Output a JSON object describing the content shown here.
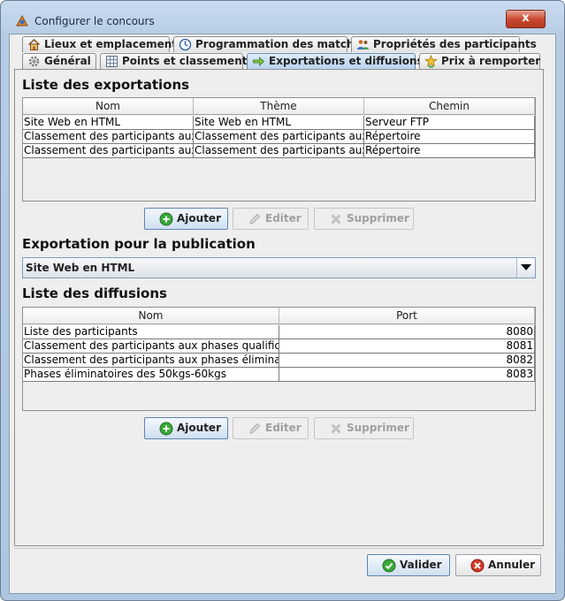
{
  "window": {
    "title": "Configurer le concours",
    "close_label": "x"
  },
  "tabs": {
    "row1": [
      {
        "label": "Lieux et emplacements",
        "icon": "house-icon"
      },
      {
        "label": "Programmation des matchs",
        "icon": "clock-icon"
      },
      {
        "label": "Propriétés des participants",
        "icon": "people-icon"
      }
    ],
    "row2": [
      {
        "label": "Général",
        "icon": "gear-icon"
      },
      {
        "label": "Points et classement",
        "icon": "grid-icon"
      },
      {
        "label": "Exportations et diffusions",
        "icon": "arrow-right-icon",
        "active": true
      },
      {
        "label": "Prix à remporter",
        "icon": "trophy-icon"
      }
    ]
  },
  "exports": {
    "title": "Liste des exportations",
    "columns": [
      "Nom",
      "Thème",
      "Chemin"
    ],
    "rows": [
      [
        "Site Web en HTML",
        "Site Web en HTML",
        "Serveur FTP"
      ],
      [
        "Classement des participants aux...",
        "Classement des participants aux...",
        "Répertoire"
      ],
      [
        "Classement des participants aux...",
        "Classement des participants aux...",
        "Répertoire"
      ]
    ],
    "buttons": {
      "add": "Ajouter",
      "edit": "Editer",
      "delete": "Supprimer"
    }
  },
  "publication": {
    "title": "Exportation pour la publication",
    "selected": "Site Web en HTML"
  },
  "broadcasts": {
    "title": "Liste des diffusions",
    "columns": [
      "Nom",
      "Port"
    ],
    "rows": [
      [
        "Liste des participants",
        "8080"
      ],
      [
        "Classement des participants aux phases qualificat...",
        "8081"
      ],
      [
        "Classement des participants aux phases éliminat...",
        "8082"
      ],
      [
        "Phases éliminatoires des 50kgs-60kgs",
        "8083"
      ]
    ],
    "buttons": {
      "add": "Ajouter",
      "edit": "Editer",
      "delete": "Supprimer"
    }
  },
  "footer": {
    "validate": "Valider",
    "cancel": "Annuler"
  },
  "colors": {
    "accent_green": "#3aa93a",
    "cancel_red": "#d23b2a",
    "window_frame": "#b7cce4"
  }
}
